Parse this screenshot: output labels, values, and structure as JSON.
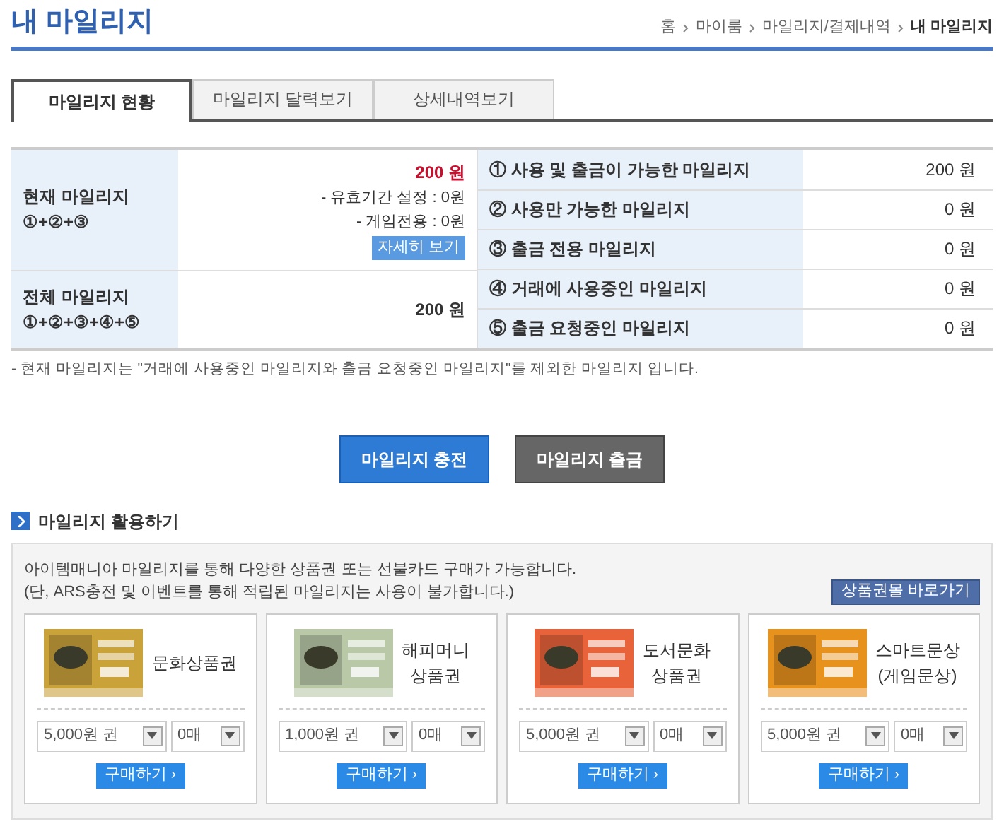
{
  "title": "내 마일리지",
  "breadcrumb": [
    {
      "label": "홈",
      "current": false
    },
    {
      "label": "마이룸",
      "current": false
    },
    {
      "label": "마일리지/결제내역",
      "current": false
    },
    {
      "label": "내 마일리지",
      "current": true
    }
  ],
  "tabs": [
    {
      "label": "마일리지 현황",
      "selected": true
    },
    {
      "label": "마일리지 달력보기",
      "selected": false
    },
    {
      "label": "상세내역보기",
      "selected": false
    }
  ],
  "summary": {
    "current": {
      "label": "현재 마일리지",
      "formula": "①+②+③",
      "amount": "200 원",
      "details": [
        "- 유효기간 설정 : 0원",
        "- 게임전용 : 0원"
      ],
      "detail_button": "자세히 보기"
    },
    "total": {
      "label": "전체 마일리지",
      "formula": "①+②+③+④+⑤",
      "amount": "200 원"
    }
  },
  "breakdown": [
    {
      "label": "① 사용 및 출금이 가능한 마일리지",
      "amount": "200 원"
    },
    {
      "label": "② 사용만 가능한 마일리지",
      "amount": "0 원"
    },
    {
      "label": "③ 출금 전용 마일리지",
      "amount": "0 원"
    },
    {
      "label": "④ 거래에 사용중인 마일리지",
      "amount": "0 원"
    },
    {
      "label": "⑤ 출금 요청중인 마일리지",
      "amount": "0 원"
    }
  ],
  "note": "- 현재 마일리지는 \"거래에 사용중인 마일리지와 출금 요청중인 마일리지\"를 제외한 마일리지 입니다.",
  "actions": [
    {
      "label": "마일리지 충전",
      "kind": "primary"
    },
    {
      "label": "마일리지 출금",
      "kind": "secondary"
    }
  ],
  "usage": {
    "heading": "마일리지 활용하기",
    "lines": [
      "아이템매니아 마일리지를 통해 다양한 상품권 또는 선불카드 구매가 가능합니다.",
      "(단, ARS충전 및 이벤트를 통해 적립된 마일리지는 사용이 불가합니다.)"
    ],
    "shop_button": "상품권몰 바로가기",
    "cards": [
      {
        "name": "문화상품권",
        "denomination": "5,000원 권",
        "quantity": "0매",
        "buy": "구매하기 ›",
        "color": "#c9a23a"
      },
      {
        "name": "해피머니\n상품권",
        "denomination": "1,000원 권",
        "quantity": "0매",
        "buy": "구매하기 ›",
        "color": "#b9c9a8"
      },
      {
        "name": "도서문화\n상품권",
        "denomination": "5,000원 권",
        "quantity": "0매",
        "buy": "구매하기 ›",
        "color": "#e8633a"
      },
      {
        "name": "스마트문상\n(게임문상)",
        "denomination": "5,000원 권",
        "quantity": "0매",
        "buy": "구매하기 ›",
        "color": "#e8921e"
      }
    ]
  }
}
